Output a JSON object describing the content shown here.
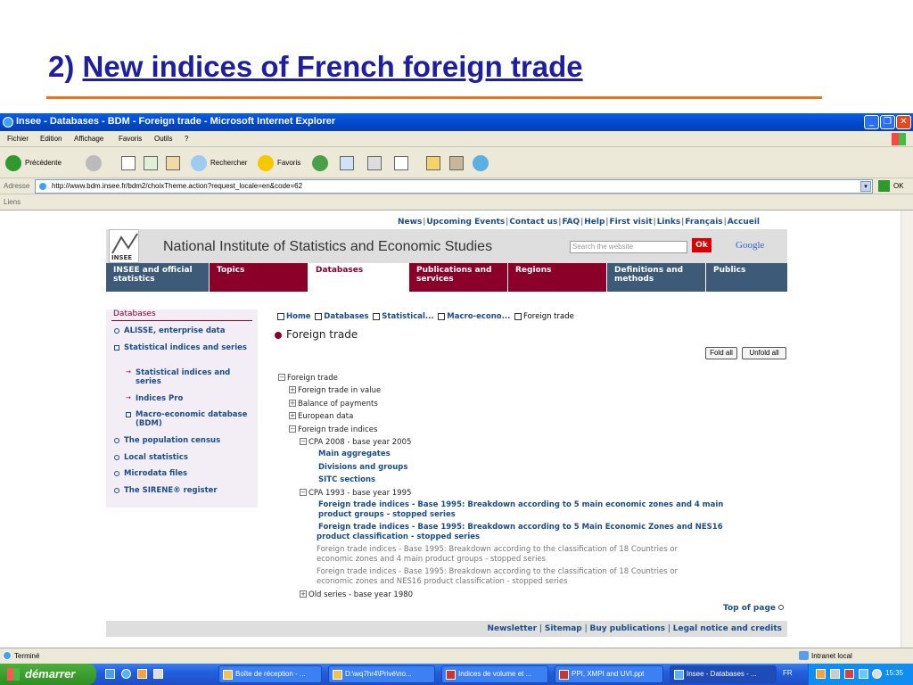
{
  "slide": {
    "title_prefix": "2) ",
    "title_link": "New indices of French foreign trade",
    "accent_color": "#e8741e",
    "title_color": "#1f1f9e"
  },
  "window": {
    "title": "Insee - Databases - BDM - Foreign trade - Microsoft Internet Explorer",
    "menu": [
      "Fichier",
      "Edition",
      "Affichage",
      "Favoris",
      "Outils",
      "?"
    ],
    "toolbar": {
      "back_label": "Précédente",
      "search_label": "Rechercher",
      "favorites_label": "Favoris"
    },
    "address_label": "Adresse",
    "address_url": "http://www.bdm.insee.fr/bdm2/choixTheme.action?request_locale=en&code=62",
    "go_label": "OK",
    "links_label": "Liens",
    "status": "Terminé",
    "zone": "Intranet local"
  },
  "site": {
    "top_links": [
      "News",
      "Upcoming Events",
      "Contact us",
      "FAQ",
      "Help",
      "First visit",
      "Links",
      "Français",
      "Accueil"
    ],
    "logo_text": "INSEE",
    "banner_title": "National Institute of Statistics and Economic Studies",
    "search_placeholder": "Search the website",
    "search_button": "Ok",
    "google": "Google",
    "nav_tabs": [
      {
        "label": "INSEE and official statistics",
        "color": "#3d5a78"
      },
      {
        "label": "Topics",
        "color": "#8b0028"
      },
      {
        "label": "Databases",
        "color": "#ffffff"
      },
      {
        "label": "Publications and services",
        "color": "#8b0028"
      },
      {
        "label": "Regions",
        "color": "#8b0028"
      },
      {
        "label": "Definitions and methods",
        "color": "#3d5a78"
      },
      {
        "label": "Publics",
        "color": "#3d5a78"
      }
    ],
    "leftnav": {
      "title": "Databases",
      "items": [
        "ALISSE, enterprise data",
        "Statistical indices and series",
        "Statistical indices and series",
        "Indices Pro",
        "Macro-economic database (BDM)",
        "The population census",
        "Local statistics",
        "Microdata files",
        "The SIRENE® register"
      ]
    },
    "breadcrumb": [
      "Home",
      "Databases",
      "Statistical...",
      "Macro-econo...",
      "Foreign trade"
    ],
    "heading": "Foreign trade",
    "fold_all": "Fold all",
    "unfold_all": "Unfold all",
    "tree": {
      "root": "Foreign trade",
      "n1": "Foreign trade in value",
      "n2": "Balance of payments",
      "n3": "European data",
      "n4": "Foreign trade indices",
      "cpa2008": "CPA 2008 - base year 2005",
      "c1": "Main aggregates",
      "c2": "Divisions and groups",
      "c3": "SITC sections",
      "cpa1993": "CPA 1993 - base year 1995",
      "d1a": "Foreign trade indices - Base 1995: Breakdown according to 5 main economic zones and 4 main",
      "d1b": "product groups - stopped series",
      "d2a": "Foreign trade indices - Base 1995: Breakdown according to 5 Main Economic Zones and NES16",
      "d2b": "product classification - stopped series",
      "d3a": "Foreign trade indices - Base 1995: Breakdown according to the classification of 18 Countries or",
      "d3b": "economic zones and 4 main product groups - stopped series",
      "d4a": "Foreign trade indices - Base 1995: Breakdown according to the classification of 18 Countries or",
      "d4b": "economic zones and NES16 product classification - stopped series",
      "old": "Old series - base year 1980"
    },
    "top_of_page": "Top of page",
    "footer_links": [
      "Newsletter",
      "Sitemap",
      "Buy publications",
      "Legal notice and credits"
    ]
  },
  "taskbar": {
    "start": "démarrer",
    "items": [
      "Boîte de réception - ...",
      "D:\\wq7hr4\\Privé\\no...",
      "Indices de volume et ...",
      "PPI, XMPI and UVI.ppt",
      "Insee - Databases - ..."
    ],
    "lang": "FR",
    "clock": "15:35"
  }
}
